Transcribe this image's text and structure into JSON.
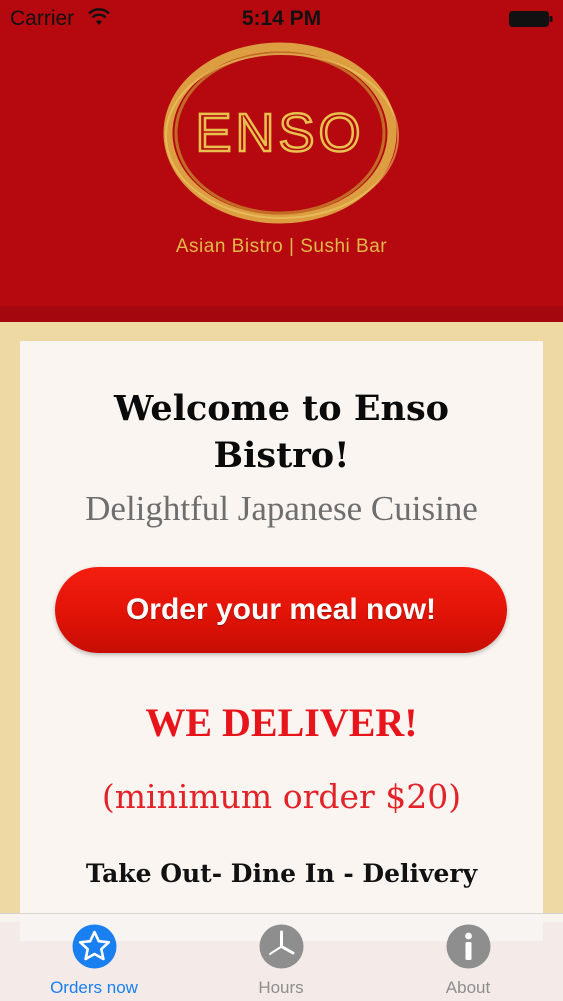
{
  "status_bar": {
    "carrier": "Carrier",
    "time": "5:14 PM",
    "icons": [
      "wifi-icon",
      "battery-icon"
    ]
  },
  "header": {
    "logo_text": "ENSO",
    "tagline": "Asian Bistro | Sushi Bar",
    "brand_color": "#b5090f",
    "gold_color": "#e3b94a"
  },
  "main": {
    "welcome": "Welcome to Enso Bistro!",
    "subtitle": "Delightful Japanese Cuisine",
    "order_button_label": "Order your meal now!",
    "deliver_heading": "WE DELIVER!",
    "minimum_order": "(minimum order $20)",
    "services": "Take Out- Dine In - Delivery",
    "accent_red": "#e8141b"
  },
  "tab_bar": {
    "tabs": [
      {
        "label": "Orders now",
        "icon": "star-icon",
        "active": true
      },
      {
        "label": "Hours",
        "icon": "clock-icon",
        "active": false
      },
      {
        "label": "About",
        "icon": "info-icon",
        "active": false
      }
    ],
    "active_color": "#1a7ff0",
    "inactive_color": "#8e8e8e"
  }
}
